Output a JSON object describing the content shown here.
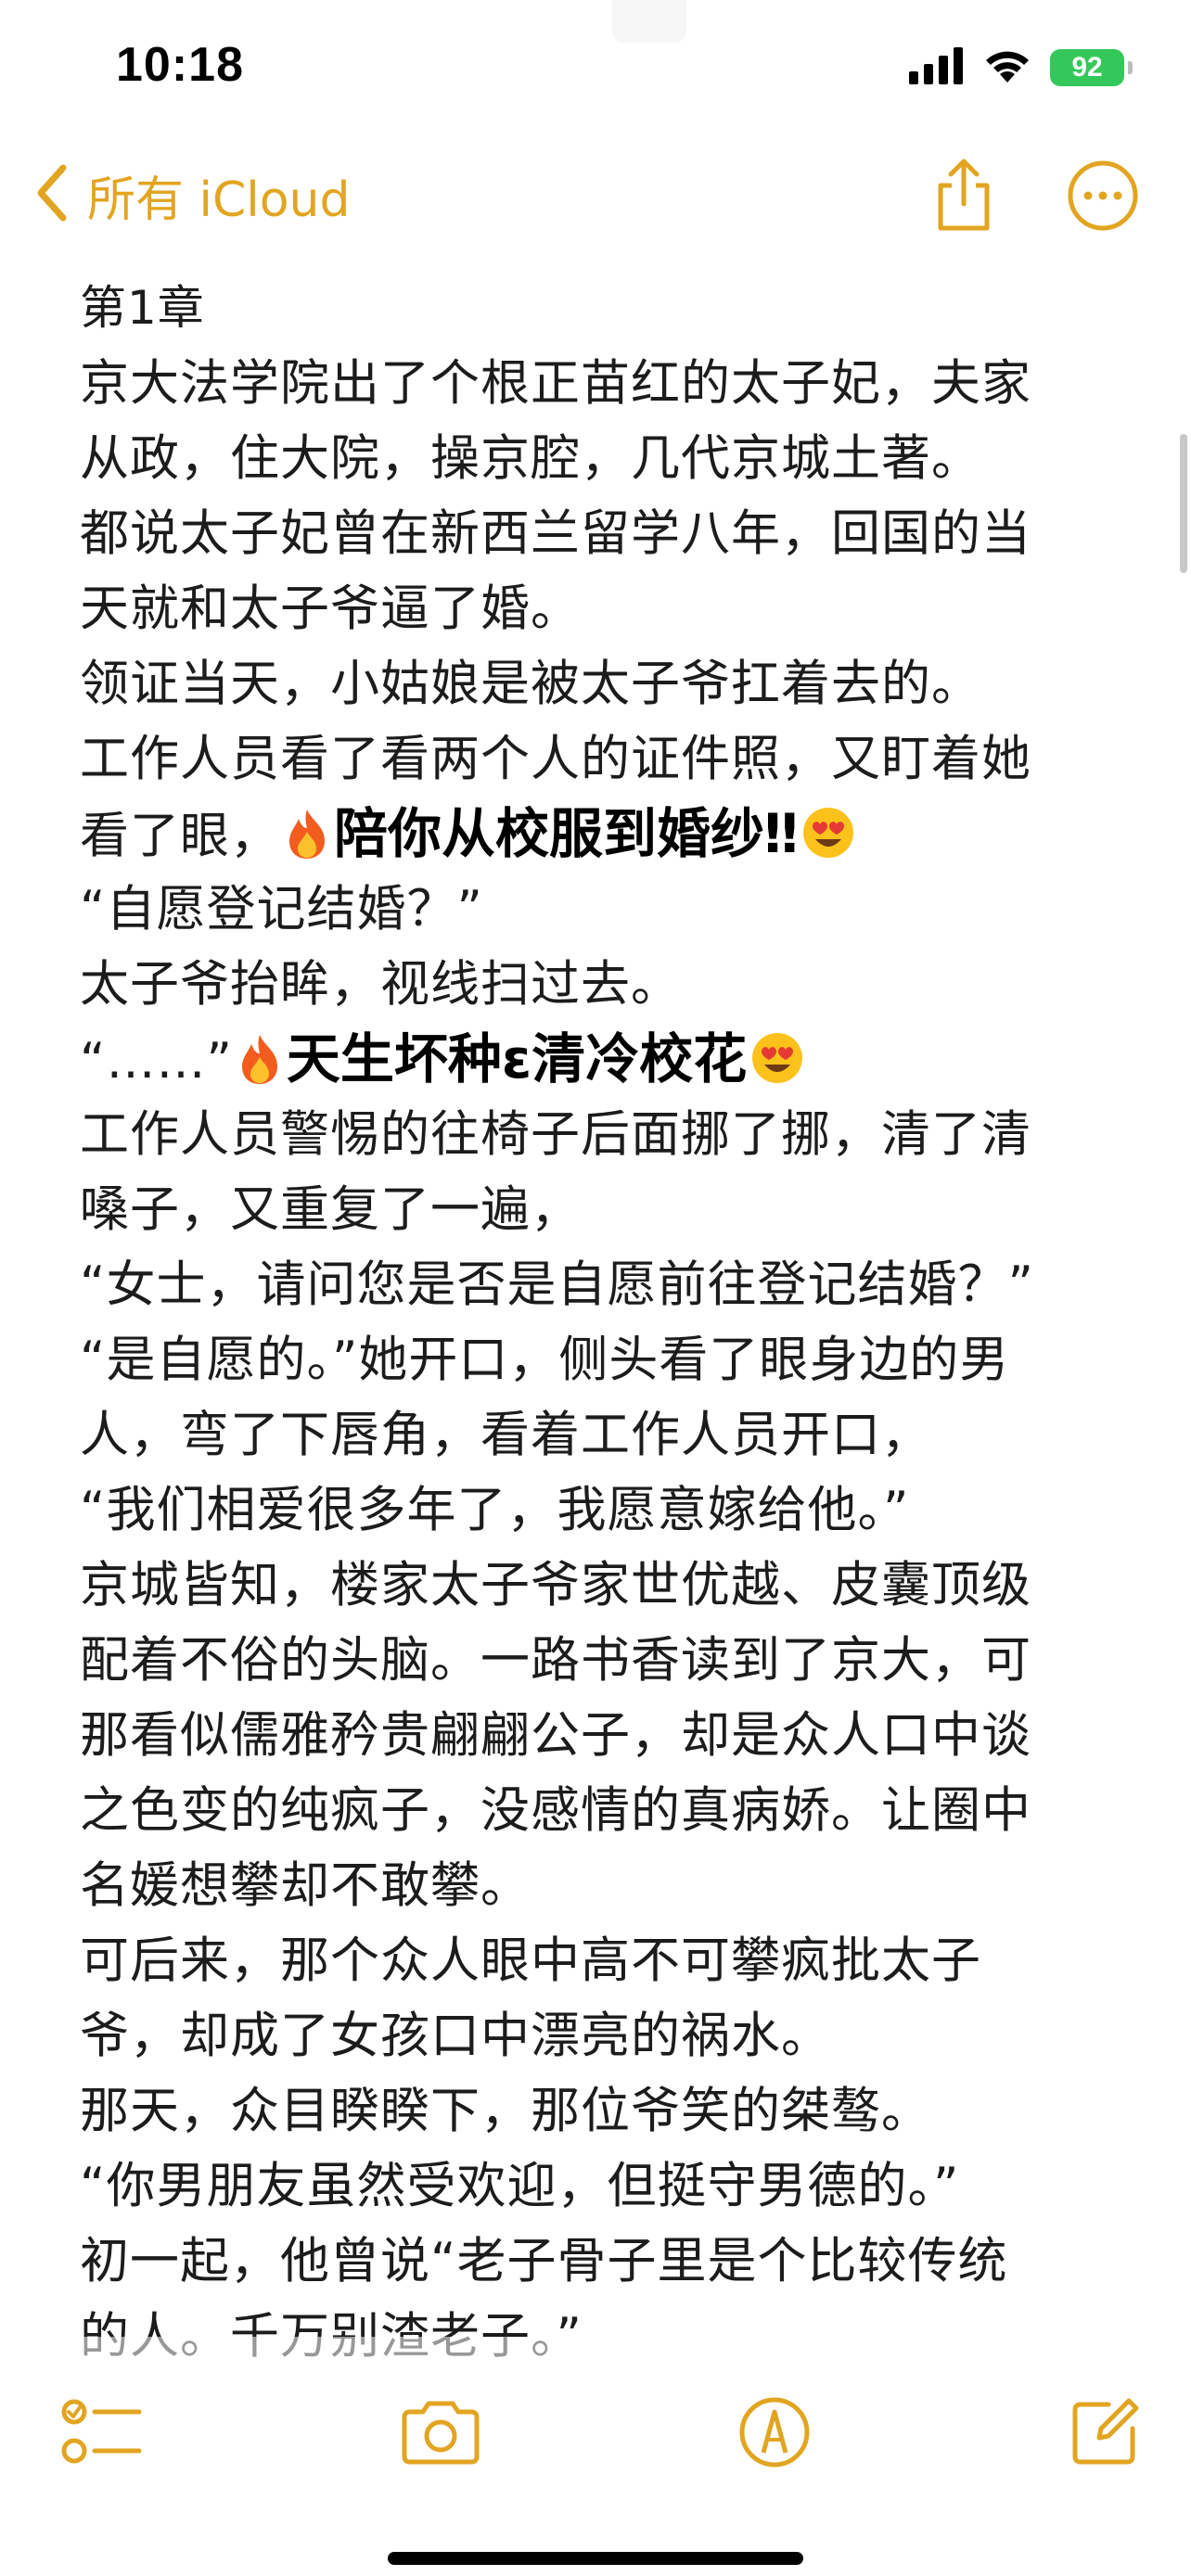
{
  "status_bar": {
    "time": "10:18",
    "battery": "92"
  },
  "nav": {
    "back_label": "所有 iCloud",
    "share_icon": "share-icon",
    "more_icon": "more-ellipsis-icon"
  },
  "note": {
    "title": "第1章",
    "lines": [
      "京大法学院出了个根正苗红的太子妃，夫家",
      "从政，住大院，操京腔，几代京城土著。",
      "都说太子妃曾在新西兰留学八年，回国的当",
      "天就和太子爷逼了婚。",
      "领证当天，小姑娘是被太子爷扛着去的。",
      "工作人员看了看两个人的证件照，又盯着她"
    ],
    "line_with_banner_1": {
      "text": "看了眼，",
      "banner": "陪你从校服到婚纱‼"
    },
    "lines_b": [
      "“自愿登记结婚？”",
      "太子爷抬眸，视线扫过去。"
    ],
    "line_with_banner_2": {
      "text": "“……”",
      "banner": "天生坏种ɛ清冷校花"
    },
    "lines_c": [
      "工作人员警惕的往椅子后面挪了挪，清了清",
      "嗓子，又重复了一遍，",
      "“女士，请问您是否是自愿前往登记结婚？”",
      "“是自愿的。”她开口，侧头看了眼身边的男",
      "人，弯了下唇角，看着工作人员开口，",
      "“我们相爱很多年了，我愿意嫁给他。”",
      "京城皆知，楼家太子爷家世优越、皮囊顶级",
      "配着不俗的头脑。一路书香读到了京大，可",
      "那看似儒雅矜贵翩翩公子，却是众人口中谈",
      "之色变的纯疯子，没感情的真病娇。让圈中",
      "名媛想攀却不敢攀。",
      "可后来，那个众人眼中高不可攀疯批太子",
      "爷，却成了女孩口中漂亮的祸水。",
      "那天，众目睽睽下，那位爷笑的桀骜。",
      "“你男朋友虽然受欢迎，但挺守男德的。”",
      "初一起，他曾说“老子骨子里是个比较传统",
      "的人。千万别渣老子。”"
    ],
    "colors": {
      "accent": "#e2a521",
      "battery": "#34c759",
      "text": "#1c1c1c"
    }
  },
  "toolbar": {
    "checklist_icon": "checklist-icon",
    "camera_icon": "camera-icon",
    "markup_icon": "markup-pen-icon",
    "compose_icon": "compose-icon"
  }
}
